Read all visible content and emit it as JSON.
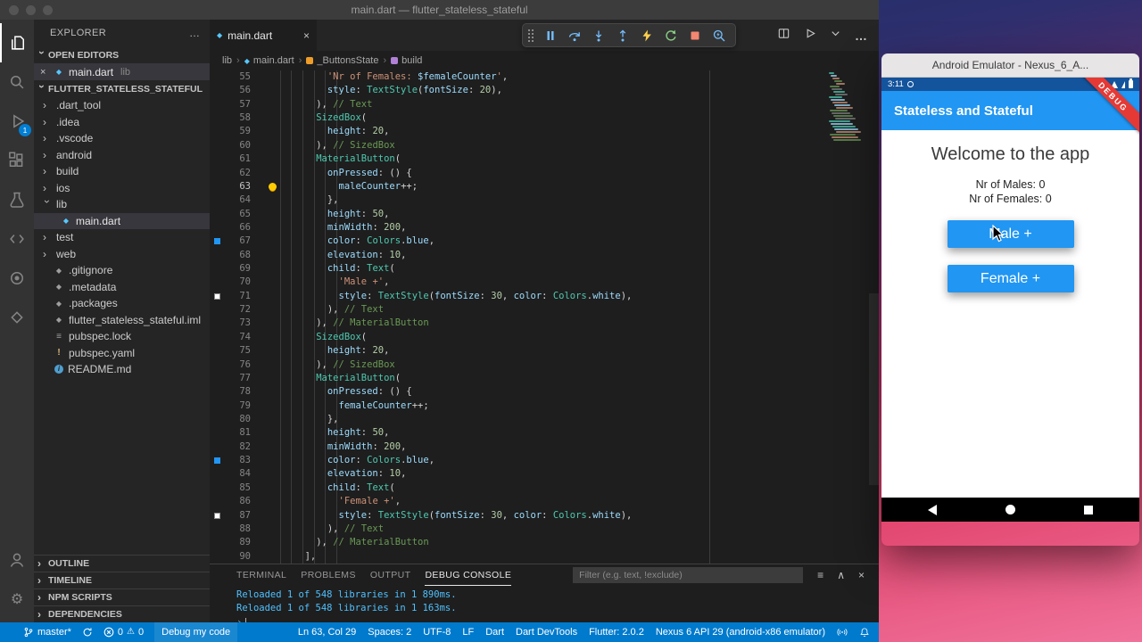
{
  "window": {
    "title": "main.dart — flutter_stateless_stateful"
  },
  "activity_bar": {
    "badge": "1"
  },
  "sidebar": {
    "title": "EXPLORER",
    "open_editors_header": "OPEN EDITORS",
    "open_editor": {
      "name": "main.dart",
      "detail": "lib"
    },
    "project_header": "FLUTTER_STATELESS_STATEFUL",
    "tree": [
      {
        "label": ".dart_tool",
        "kind": "folder",
        "depth": 0
      },
      {
        "label": ".idea",
        "kind": "folder",
        "depth": 0
      },
      {
        "label": ".vscode",
        "kind": "folder",
        "depth": 0
      },
      {
        "label": "android",
        "kind": "folder",
        "depth": 0
      },
      {
        "label": "build",
        "kind": "folder",
        "depth": 0
      },
      {
        "label": "ios",
        "kind": "folder",
        "depth": 0
      },
      {
        "label": "lib",
        "kind": "folder",
        "depth": 0,
        "expanded": true
      },
      {
        "label": "main.dart",
        "kind": "file",
        "depth": 1,
        "selected": true,
        "icon": "dart"
      },
      {
        "label": "test",
        "kind": "folder",
        "depth": 0
      },
      {
        "label": "web",
        "kind": "folder",
        "depth": 0
      },
      {
        "label": ".gitignore",
        "kind": "file",
        "depth": 0,
        "icon": "git"
      },
      {
        "label": ".metadata",
        "kind": "file",
        "depth": 0,
        "icon": "meta"
      },
      {
        "label": ".packages",
        "kind": "file",
        "depth": 0,
        "icon": "meta"
      },
      {
        "label": "flutter_stateless_stateful.iml",
        "kind": "file",
        "depth": 0,
        "icon": "meta"
      },
      {
        "label": "pubspec.lock",
        "kind": "file",
        "depth": 0,
        "icon": "lock"
      },
      {
        "label": "pubspec.yaml",
        "kind": "file",
        "depth": 0,
        "icon": "yaml"
      },
      {
        "label": "README.md",
        "kind": "file",
        "depth": 0,
        "icon": "readme"
      }
    ],
    "bottom_sections": [
      {
        "label": "OUTLINE"
      },
      {
        "label": "TIMELINE"
      },
      {
        "label": "NPM SCRIPTS"
      },
      {
        "label": "DEPENDENCIES"
      }
    ]
  },
  "editor": {
    "tab": "main.dart",
    "breadcrumbs": [
      {
        "label": "lib",
        "icon": null
      },
      {
        "label": "main.dart",
        "icon": "dart"
      },
      {
        "label": "_ButtonsState",
        "icon": "class"
      },
      {
        "label": "build",
        "icon": "method"
      }
    ],
    "code": {
      "active_line": 63,
      "lines": [
        {
          "n": 55,
          "i": 12,
          "t": [
            [
              "str",
              "'Nr of Females: "
            ],
            [
              "var",
              "$femaleCounter"
            ],
            [
              "str",
              "'"
            ],
            [
              "pun",
              ","
            ]
          ]
        },
        {
          "n": 56,
          "i": 12,
          "t": [
            [
              "var",
              "style"
            ],
            [
              "pun",
              ": "
            ],
            [
              "cls",
              "TextStyle"
            ],
            [
              "pun",
              "("
            ],
            [
              "var",
              "fontSize"
            ],
            [
              "pun",
              ": "
            ],
            [
              "num",
              "20"
            ],
            [
              "pun",
              "),"
            ]
          ]
        },
        {
          "n": 57,
          "i": 10,
          "t": [
            [
              "pun",
              "), "
            ],
            [
              "com",
              "// Text"
            ]
          ]
        },
        {
          "n": 58,
          "i": 10,
          "t": [
            [
              "cls",
              "SizedBox"
            ],
            [
              "pun",
              "("
            ]
          ]
        },
        {
          "n": 59,
          "i": 12,
          "t": [
            [
              "var",
              "height"
            ],
            [
              "pun",
              ": "
            ],
            [
              "num",
              "20"
            ],
            [
              "pun",
              ","
            ]
          ]
        },
        {
          "n": 60,
          "i": 10,
          "t": [
            [
              "pun",
              "), "
            ],
            [
              "com",
              "// SizedBox"
            ]
          ]
        },
        {
          "n": 61,
          "i": 10,
          "t": [
            [
              "cls",
              "MaterialButton"
            ],
            [
              "pun",
              "("
            ]
          ]
        },
        {
          "n": 62,
          "i": 12,
          "t": [
            [
              "var",
              "onPressed"
            ],
            [
              "pun",
              ": () {"
            ]
          ]
        },
        {
          "n": 63,
          "i": 14,
          "bulb": true,
          "t": [
            [
              "var",
              "maleCounter"
            ],
            [
              "pun",
              "++;"
            ]
          ]
        },
        {
          "n": 64,
          "i": 12,
          "t": [
            [
              "pun",
              "},"
            ]
          ]
        },
        {
          "n": 65,
          "i": 12,
          "t": [
            [
              "var",
              "height"
            ],
            [
              "pun",
              ": "
            ],
            [
              "num",
              "50"
            ],
            [
              "pun",
              ","
            ]
          ]
        },
        {
          "n": 66,
          "i": 12,
          "t": [
            [
              "var",
              "minWidth"
            ],
            [
              "pun",
              ": "
            ],
            [
              "num",
              "200"
            ],
            [
              "pun",
              ","
            ]
          ]
        },
        {
          "n": 67,
          "i": 12,
          "sw": "#2196f3",
          "t": [
            [
              "var",
              "color"
            ],
            [
              "pun",
              ": "
            ],
            [
              "cls",
              "Colors"
            ],
            [
              "pun",
              "."
            ],
            [
              "var",
              "blue"
            ],
            [
              "pun",
              ","
            ]
          ]
        },
        {
          "n": 68,
          "i": 12,
          "t": [
            [
              "var",
              "elevation"
            ],
            [
              "pun",
              ": "
            ],
            [
              "num",
              "10"
            ],
            [
              "pun",
              ","
            ]
          ]
        },
        {
          "n": 69,
          "i": 12,
          "t": [
            [
              "var",
              "child"
            ],
            [
              "pun",
              ": "
            ],
            [
              "cls",
              "Text"
            ],
            [
              "pun",
              "("
            ]
          ]
        },
        {
          "n": 70,
          "i": 14,
          "t": [
            [
              "str",
              "'Male +'"
            ],
            [
              "pun",
              ","
            ]
          ]
        },
        {
          "n": 71,
          "i": 14,
          "sw": "#ffffff",
          "t": [
            [
              "var",
              "style"
            ],
            [
              "pun",
              ": "
            ],
            [
              "cls",
              "TextStyle"
            ],
            [
              "pun",
              "("
            ],
            [
              "var",
              "fontSize"
            ],
            [
              "pun",
              ": "
            ],
            [
              "num",
              "30"
            ],
            [
              "pun",
              ", "
            ],
            [
              "var",
              "color"
            ],
            [
              "pun",
              ": "
            ],
            [
              "cls",
              "Colors"
            ],
            [
              "pun",
              "."
            ],
            [
              "var",
              "white"
            ],
            [
              "pun",
              "),"
            ]
          ]
        },
        {
          "n": 72,
          "i": 12,
          "t": [
            [
              "pun",
              "), "
            ],
            [
              "com",
              "// Text"
            ]
          ]
        },
        {
          "n": 73,
          "i": 10,
          "t": [
            [
              "pun",
              "), "
            ],
            [
              "com",
              "// MaterialButton"
            ]
          ]
        },
        {
          "n": 74,
          "i": 10,
          "t": [
            [
              "cls",
              "SizedBox"
            ],
            [
              "pun",
              "("
            ]
          ]
        },
        {
          "n": 75,
          "i": 12,
          "t": [
            [
              "var",
              "height"
            ],
            [
              "pun",
              ": "
            ],
            [
              "num",
              "20"
            ],
            [
              "pun",
              ","
            ]
          ]
        },
        {
          "n": 76,
          "i": 10,
          "t": [
            [
              "pun",
              "), "
            ],
            [
              "com",
              "// SizedBox"
            ]
          ]
        },
        {
          "n": 77,
          "i": 10,
          "t": [
            [
              "cls",
              "MaterialButton"
            ],
            [
              "pun",
              "("
            ]
          ]
        },
        {
          "n": 78,
          "i": 12,
          "t": [
            [
              "var",
              "onPressed"
            ],
            [
              "pun",
              ": () {"
            ]
          ]
        },
        {
          "n": 79,
          "i": 14,
          "t": [
            [
              "var",
              "femaleCounter"
            ],
            [
              "pun",
              "++;"
            ]
          ]
        },
        {
          "n": 80,
          "i": 12,
          "t": [
            [
              "pun",
              "},"
            ]
          ]
        },
        {
          "n": 81,
          "i": 12,
          "t": [
            [
              "var",
              "height"
            ],
            [
              "pun",
              ": "
            ],
            [
              "num",
              "50"
            ],
            [
              "pun",
              ","
            ]
          ]
        },
        {
          "n": 82,
          "i": 12,
          "t": [
            [
              "var",
              "minWidth"
            ],
            [
              "pun",
              ": "
            ],
            [
              "num",
              "200"
            ],
            [
              "pun",
              ","
            ]
          ]
        },
        {
          "n": 83,
          "i": 12,
          "sw": "#2196f3",
          "t": [
            [
              "var",
              "color"
            ],
            [
              "pun",
              ": "
            ],
            [
              "cls",
              "Colors"
            ],
            [
              "pun",
              "."
            ],
            [
              "var",
              "blue"
            ],
            [
              "pun",
              ","
            ]
          ]
        },
        {
          "n": 84,
          "i": 12,
          "t": [
            [
              "var",
              "elevation"
            ],
            [
              "pun",
              ": "
            ],
            [
              "num",
              "10"
            ],
            [
              "pun",
              ","
            ]
          ]
        },
        {
          "n": 85,
          "i": 12,
          "t": [
            [
              "var",
              "child"
            ],
            [
              "pun",
              ": "
            ],
            [
              "cls",
              "Text"
            ],
            [
              "pun",
              "("
            ]
          ]
        },
        {
          "n": 86,
          "i": 14,
          "t": [
            [
              "str",
              "'Female +'"
            ],
            [
              "pun",
              ","
            ]
          ]
        },
        {
          "n": 87,
          "i": 14,
          "sw": "#ffffff",
          "t": [
            [
              "var",
              "style"
            ],
            [
              "pun",
              ": "
            ],
            [
              "cls",
              "TextStyle"
            ],
            [
              "pun",
              "("
            ],
            [
              "var",
              "fontSize"
            ],
            [
              "pun",
              ": "
            ],
            [
              "num",
              "30"
            ],
            [
              "pun",
              ", "
            ],
            [
              "var",
              "color"
            ],
            [
              "pun",
              ": "
            ],
            [
              "cls",
              "Colors"
            ],
            [
              "pun",
              "."
            ],
            [
              "var",
              "white"
            ],
            [
              "pun",
              "),"
            ]
          ]
        },
        {
          "n": 88,
          "i": 12,
          "t": [
            [
              "pun",
              "), "
            ],
            [
              "com",
              "// Text"
            ]
          ]
        },
        {
          "n": 89,
          "i": 10,
          "t": [
            [
              "pun",
              "), "
            ],
            [
              "com",
              "// MaterialButton"
            ]
          ]
        },
        {
          "n": 90,
          "i": 8,
          "t": [
            [
              "pun",
              "],"
            ]
          ]
        }
      ]
    }
  },
  "panel": {
    "tabs": [
      {
        "label": "TERMINAL",
        "active": false
      },
      {
        "label": "PROBLEMS",
        "active": false
      },
      {
        "label": "OUTPUT",
        "active": false
      },
      {
        "label": "DEBUG CONSOLE",
        "active": true
      }
    ],
    "filter_placeholder": "Filter (e.g. text, !exclude)",
    "console_lines": [
      "Reloaded 1 of 548 libraries in 1 890ms.",
      "Reloaded 1 of 548 libraries in 1 163ms."
    ],
    "prompt": "›"
  },
  "status_bar": {
    "branch": "master*",
    "errors": "0",
    "warnings": "0",
    "debug_config": "Debug my code",
    "line_col": "Ln 63, Col 29",
    "spaces": "Spaces: 2",
    "encoding": "UTF-8",
    "eol": "LF",
    "language": "Dart",
    "devtools": "Dart DevTools",
    "flutter": "Flutter: 2.0.2",
    "device": "Nexus 6 API 29 (android-x86 emulator)"
  },
  "emulator": {
    "window_title": "Android Emulator - Nexus_6_A...",
    "status_time": "3:11",
    "app_title": "Stateless and Stateful",
    "debug_banner": "DEBUG",
    "welcome": "Welcome to the app",
    "males_label": "Nr of Males: 0",
    "females_label": "Nr of Females: 0",
    "male_button": "Male +",
    "female_button": "Female +"
  },
  "colors": {
    "status_bar": "#007acc",
    "app_accent": "#2196f3",
    "debug_banner": "#e53935",
    "editor_bg": "#1e1e1e",
    "swatch_blue": "#2196f3",
    "swatch_white": "#ffffff"
  }
}
